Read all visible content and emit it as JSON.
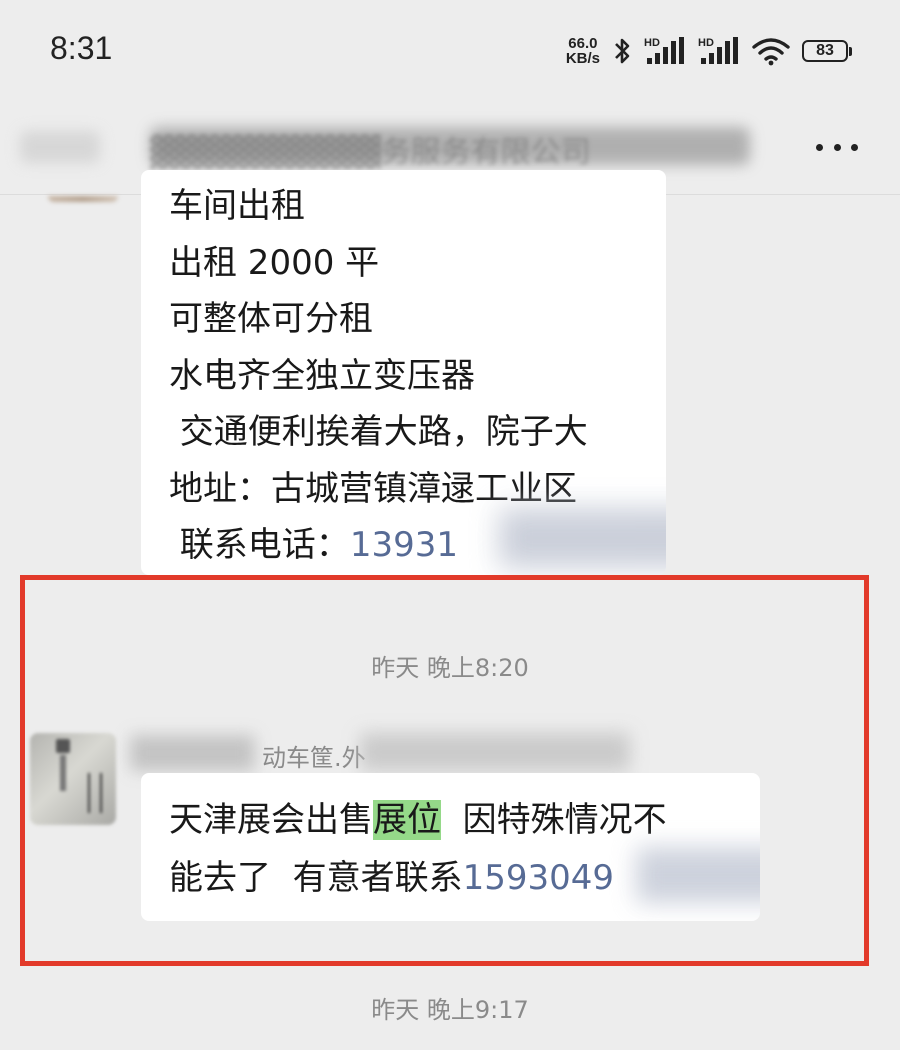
{
  "status_bar": {
    "time": "8:31",
    "net_speed_value": "66.0",
    "net_speed_unit": "KB/s",
    "bluetooth_icon": "bluetooth-icon",
    "signal1_label": "HD",
    "signal2_label": "HD",
    "wifi_icon": "wifi-icon",
    "battery": "83"
  },
  "header": {
    "title": "▓▓▓▓▓▓▓▓▓▓务服务有限公司",
    "more_icon": "more-icon"
  },
  "messages": {
    "msg1": {
      "lines": [
        "车间出租",
        "出租 2000 平",
        "可整体可分租",
        "水电齐全独立变压器",
        " 交通便利挨着大路，院子大",
        "地址：古城营镇漳逯工业区"
      ],
      "contact_prefix": " 联系电话：",
      "phone": "13931"
    },
    "ts1": "昨天 晚上8:20",
    "msg2": {
      "sender": "动车筐.外",
      "line1_before": "天津展会出售",
      "line1_highlight": "展位",
      "line1_after": "  因特殊情况不",
      "line2_text": "能去了  有意者联系",
      "line2_phone": "1593049"
    },
    "ts2": "昨天 晚上9:17"
  },
  "colors": {
    "background": "#ededed",
    "bubble": "#ffffff",
    "link": "#576b95",
    "highlight": "#95d989",
    "frame": "#e23a2a"
  }
}
